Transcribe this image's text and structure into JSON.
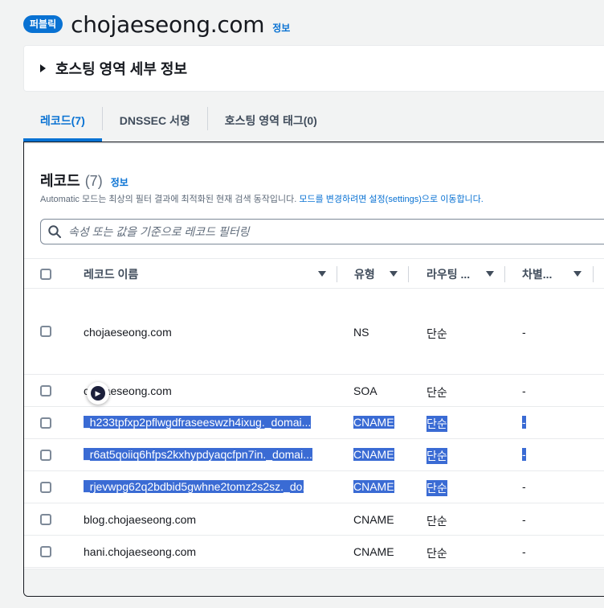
{
  "header": {
    "badge": "퍼블릭",
    "title": "chojaeseong.com",
    "info": "정보"
  },
  "details": {
    "label": "호스팅 영역 세부 정보"
  },
  "tabs": [
    {
      "label": "레코드(7)",
      "active": true
    },
    {
      "label": "DNSSEC 서명",
      "active": false
    },
    {
      "label": "호스팅 영역 태그(0)",
      "active": false
    }
  ],
  "records": {
    "title": "레코드",
    "count": "(7)",
    "info": "정보",
    "desc_text": "Automatic 모드는 최상의 필터 결과에 최적화된 현재 검색 동작입니다.",
    "desc_link": "모드를 변경하려면 설정(settings)으로 이동합니다.",
    "filter_placeholder": "속성 또는 값을 기준으로 레코드 필터링",
    "columns": {
      "name": "레코드 이름",
      "type": "유형",
      "routing": "라우팅 ...",
      "diff": "차별..."
    },
    "rows": [
      {
        "name": "chojaeseong.com",
        "type": "NS",
        "routing": "단순",
        "diff": "-"
      },
      {
        "name": "chojaeseong.com",
        "type": "SOA",
        "routing": "단순",
        "diff": "-"
      },
      {
        "name": "_h233tpfxp2pflwgdfraseeswzh4ixug._domai...",
        "type": "CNAME",
        "routing": "단순",
        "diff": "-"
      },
      {
        "name": "_r6at5qoiiq6hfps2kxhypdyaqcfpn7in._domai...",
        "type": "CNAME",
        "routing": "단순",
        "diff": "-"
      },
      {
        "name": "_rjevwpg62q2bdbid5gwhne2tomz2s2sz._do...",
        "type": "CNAME",
        "routing": "단순",
        "diff": "-"
      },
      {
        "name": "blog.chojaeseong.com",
        "type": "CNAME",
        "routing": "단순",
        "diff": "-"
      },
      {
        "name": "hani.chojaeseong.com",
        "type": "CNAME",
        "routing": "단순",
        "diff": "-"
      }
    ]
  },
  "colors": {
    "accent": "#0972d3",
    "selection": "#3a6bd4"
  }
}
